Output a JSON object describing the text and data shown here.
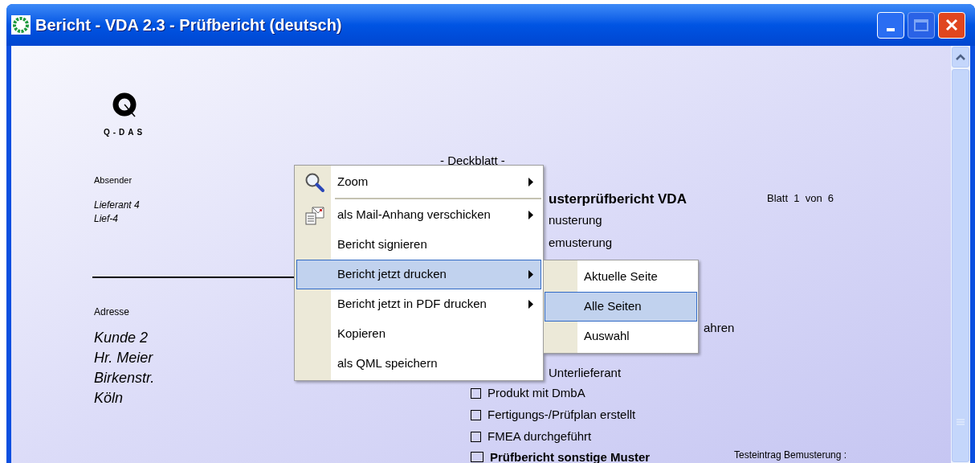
{
  "window": {
    "title": "Bericht - VDA 2.3 - Prüfbericht (deutsch)"
  },
  "report": {
    "logo_text": "Q-DAS",
    "sender_label": "Absender",
    "sender_lines": [
      "Lieferant 4",
      "Lief-4"
    ],
    "address_label": "Adresse",
    "address_lines": [
      "Kunde 2",
      "Hr. Meier",
      "Birkenstr.",
      "Köln"
    ],
    "section": "- Deckblatt -",
    "heading": "usterprüfbericht VDA",
    "sheet": "Blatt  1  von  6",
    "fragments": [
      "nusterung",
      "emusterung"
    ],
    "fragment_right": "ahren",
    "fragment_sub": "Unterlieferant",
    "checklist": [
      {
        "label": "Produkt mit DmbA",
        "checked": false,
        "kind": "normal"
      },
      {
        "label": "Fertigungs-/Prüfplan erstellt",
        "checked": false,
        "kind": "normal"
      },
      {
        "label": "FMEA durchgeführt",
        "checked": false,
        "kind": "normal"
      },
      {
        "label": "Prüfbericht sonstige Muster",
        "checked": false,
        "kind": "heading"
      }
    ],
    "side_note": "Testeintrag Bemusterung :"
  },
  "context_menu": {
    "items": [
      {
        "label": "Zoom",
        "kind": "zoom",
        "submenu": true,
        "selected": false,
        "separator_after": true
      },
      {
        "label": "als Mail-Anhang verschicken",
        "kind": "mail",
        "submenu": true,
        "selected": false,
        "separator_after": false
      },
      {
        "label": "Bericht signieren",
        "kind": "plain",
        "submenu": false,
        "selected": false,
        "separator_after": false
      },
      {
        "label": "Bericht jetzt drucken",
        "kind": "plain",
        "submenu": true,
        "selected": true,
        "separator_after": false
      },
      {
        "label": "Bericht jetzt in PDF drucken",
        "kind": "plain",
        "submenu": true,
        "selected": false,
        "separator_after": false
      },
      {
        "label": "Kopieren",
        "kind": "plain",
        "submenu": false,
        "selected": false,
        "separator_after": false
      },
      {
        "label": "als QML speichern",
        "kind": "plain",
        "submenu": false,
        "selected": false,
        "separator_after": false
      }
    ]
  },
  "submenu": {
    "items": [
      {
        "label": "Aktuelle Seite",
        "selected": false
      },
      {
        "label": "Alle Seiten",
        "selected": true
      },
      {
        "label": "Auswahl",
        "selected": false
      }
    ]
  }
}
